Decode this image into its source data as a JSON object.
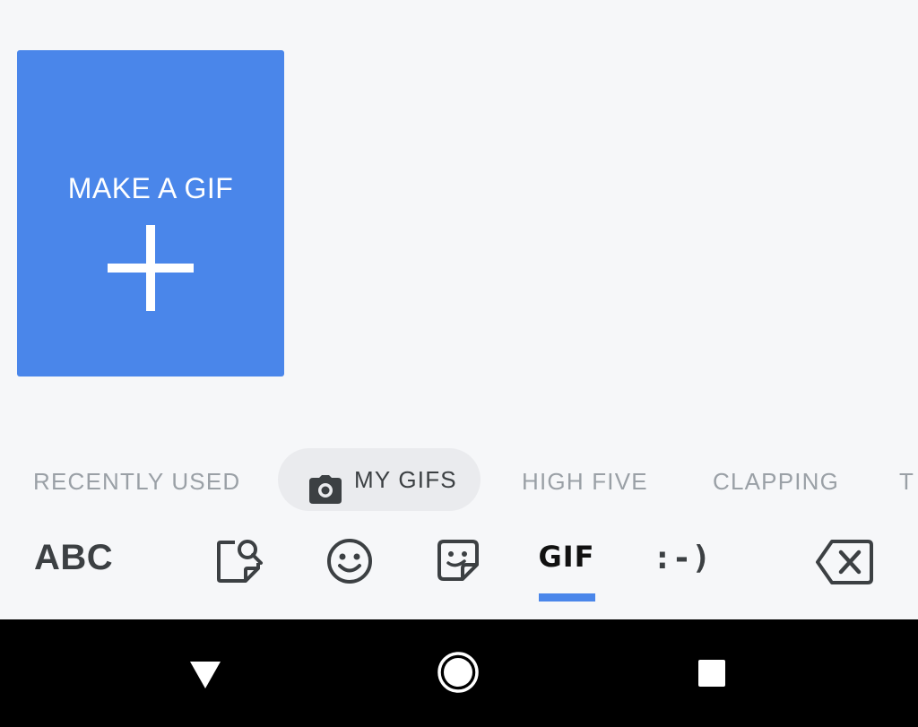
{
  "make_gif": {
    "label": "MAKE A GIF",
    "icon": "plus-icon"
  },
  "categories": [
    {
      "label": "RECENTLY USED"
    },
    {
      "label": "MY GIFS",
      "icon": "camera-icon",
      "selected": true
    },
    {
      "label": "HIGH FIVE"
    },
    {
      "label": "CLAPPING"
    },
    {
      "label": "T"
    }
  ],
  "keyboard_bar": {
    "abc_label": "ABC",
    "icons": [
      "sticker-search-icon",
      "emoji-icon",
      "sticker-icon",
      "backspace-icon"
    ],
    "gif_label": "GIF",
    "emoticon_label": ":-)",
    "selected_tab": "GIF"
  },
  "nav_bar": {
    "icons": [
      "back-icon",
      "home-icon",
      "recents-icon"
    ]
  },
  "colors": {
    "accent": "#4a86ea",
    "background": "#f6f7f9",
    "chip": "#eaebee",
    "nav": "#000000"
  }
}
